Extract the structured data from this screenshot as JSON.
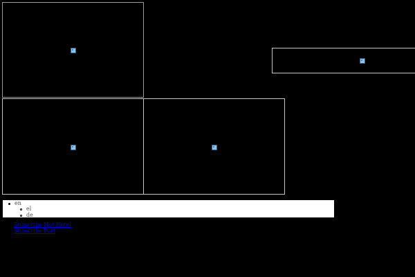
{
  "frames": [
    {
      "id": "frame-a",
      "content": "broken-image-icon"
    },
    {
      "id": "frame-b",
      "content": "broken-image-icon"
    },
    {
      "id": "frame-c",
      "content": "broken-image-icon"
    },
    {
      "id": "frame-d",
      "content": "broken-image-icon"
    }
  ],
  "language_switcher": {
    "current": "en",
    "options": [
      "el",
      "de"
    ]
  },
  "links": {
    "subscribe_hotel": "Subscribe Hot Hotel",
    "subscribe_port": "Subscribe Port"
  },
  "colors": {
    "background": "#000000",
    "frame_border": "#9a9a9a",
    "link": "#0000cc",
    "switcher_background": "#ffffff"
  }
}
